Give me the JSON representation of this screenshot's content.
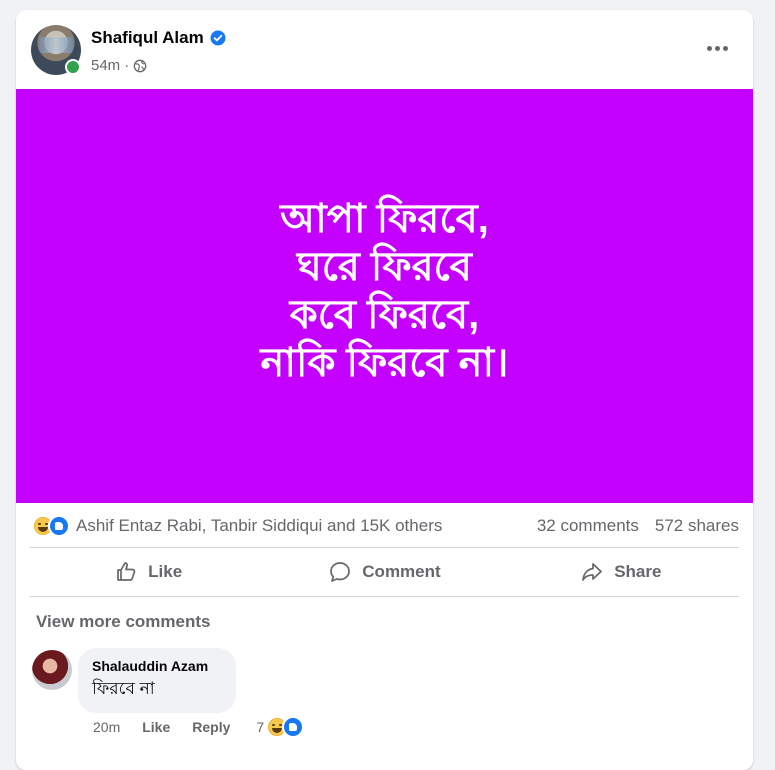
{
  "post": {
    "author": "Shafiqul Alam",
    "verified": true,
    "time": "54m",
    "separator": "·",
    "privacy_icon": "globe-icon",
    "more_icon": "more-horizontal-icon",
    "background_color": "#c400ff",
    "text": "আপা ফিরবে,\nঘরে ফিরবে\nকবে ফিরবে,\nনাকি ফিরবে না।"
  },
  "reactions": {
    "icons": [
      "haha-reaction-icon",
      "like-reaction-icon"
    ],
    "names": "Ashif Entaz Rabi, Tanbir Siddiqui and 15K others",
    "comments": "32 comments",
    "shares": "572 shares"
  },
  "actions": {
    "like": "Like",
    "comment": "Comment",
    "share": "Share"
  },
  "comments_section": {
    "view_more": "View more comments",
    "items": [
      {
        "name": "Shalauddin Azam",
        "text": "ফিরবে না",
        "time": "20m",
        "like": "Like",
        "reply": "Reply",
        "reaction_count": "7"
      }
    ]
  },
  "colors": {
    "accent": "#1877f2",
    "muted_text": "#65676b",
    "online": "#31a24c"
  }
}
